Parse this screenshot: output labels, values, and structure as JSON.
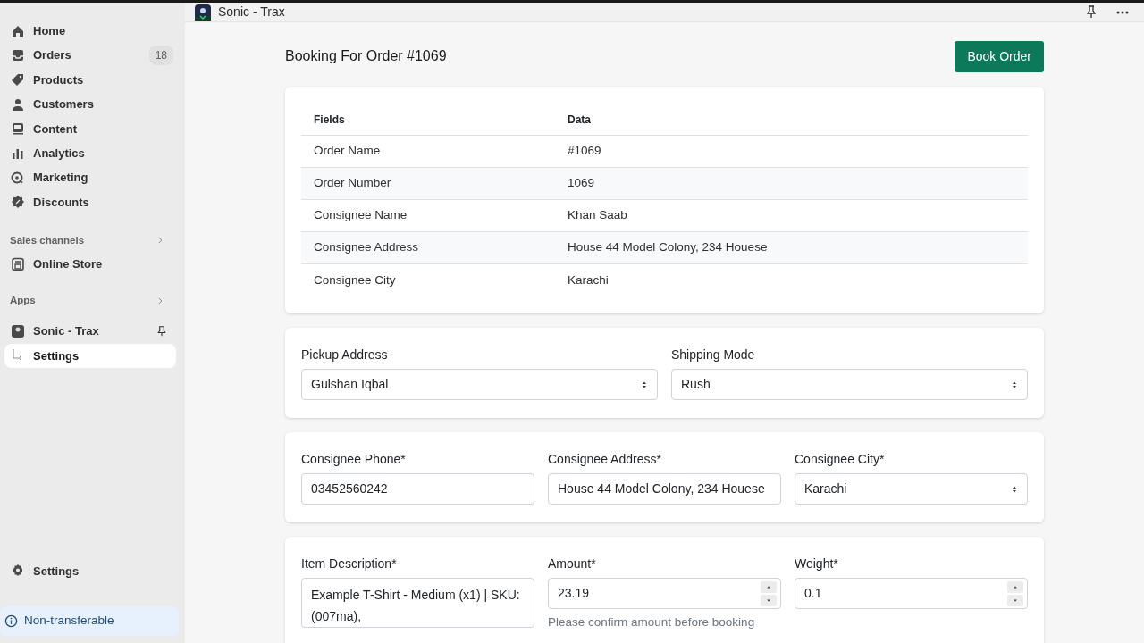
{
  "sidebar": {
    "nav": [
      {
        "label": "Home",
        "selected": false
      },
      {
        "label": "Orders",
        "badge": "18",
        "selected": false
      },
      {
        "label": "Products",
        "selected": false
      },
      {
        "label": "Customers",
        "selected": false
      },
      {
        "label": "Content",
        "selected": false
      },
      {
        "label": "Analytics",
        "selected": false
      },
      {
        "label": "Marketing",
        "selected": false
      },
      {
        "label": "Discounts",
        "selected": false
      }
    ],
    "sales_channels": {
      "title": "Sales channels",
      "items": [
        {
          "label": "Online Store",
          "selected": false
        }
      ]
    },
    "apps": {
      "title": "Apps",
      "app": {
        "label": "Sonic - Trax",
        "children": [
          {
            "label": "Settings",
            "selected": true
          }
        ]
      }
    },
    "settings": "Settings",
    "notice": "Non-transferable"
  },
  "top_bar": {
    "title": "Sonic - Trax"
  },
  "page": {
    "title": "Booking For Order #1069",
    "primary_action": "Book Order",
    "table": {
      "columns": [
        "Fields",
        "Data"
      ],
      "rows": [
        [
          "Order Name",
          "#1069"
        ],
        [
          "Order Number",
          "1069"
        ],
        [
          "Consignee Name",
          "Khan Saab"
        ],
        [
          "Consignee Address",
          "House 44 Model Colony, 234 Houese"
        ],
        [
          "Consignee City",
          "Karachi"
        ]
      ]
    },
    "sections": [
      {
        "fields": [
          {
            "kind": "select",
            "label": "Pickup Address",
            "value": "Gulshan Iqbal"
          },
          {
            "kind": "select",
            "label": "Shipping Mode",
            "value": "Rush"
          }
        ]
      },
      {
        "fields": [
          {
            "kind": "text",
            "label": "Consignee Phone*",
            "value": "03452560242"
          },
          {
            "kind": "text",
            "label": "Consignee Address*",
            "value": "House 44 Model Colony, 234 Houese"
          },
          {
            "kind": "select",
            "label": "Consignee City*",
            "value": "Karachi"
          }
        ]
      },
      {
        "fields": [
          {
            "kind": "textarea",
            "label": "Item Description*",
            "value": "Example T-Shirt - Medium (x1) | SKU: (007ma),"
          },
          {
            "kind": "number",
            "label": "Amount*",
            "value": "23.19",
            "help": "Please confirm amount before booking"
          },
          {
            "kind": "number",
            "label": "Weight*",
            "value": "0.1"
          }
        ]
      }
    ]
  }
}
